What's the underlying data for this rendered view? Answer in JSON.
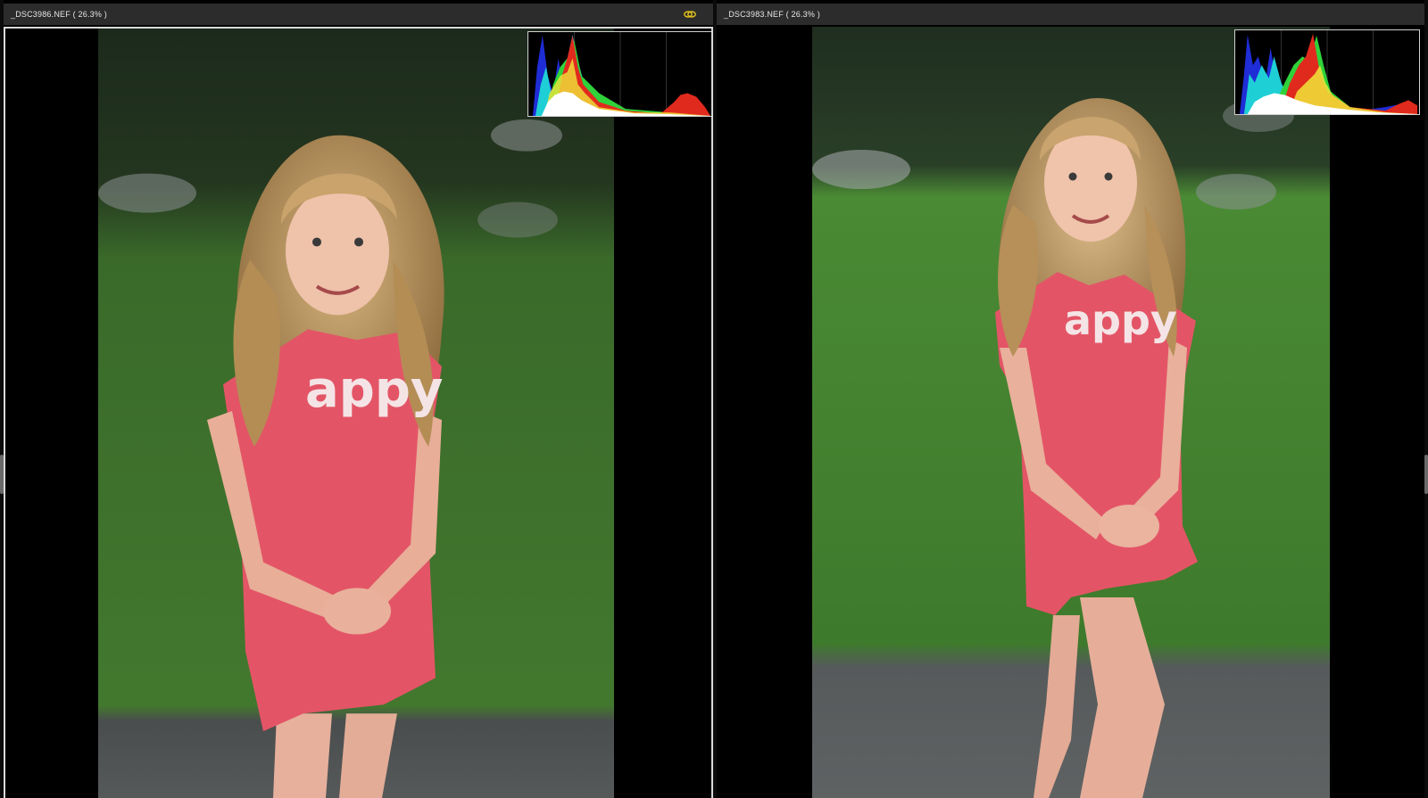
{
  "panes": [
    {
      "title": "_DSC3986.NEF ( 26.3% )",
      "zoom": "26.3%",
      "selected": true,
      "shirt_text": "appy"
    },
    {
      "title": "_DSC3983.NEF ( 26.3% )",
      "zoom": "26.3%",
      "selected": false,
      "shirt_text": "appy"
    }
  ],
  "icons": {
    "link": "link-icon",
    "link_color": "#e2c21a"
  },
  "colors": {
    "header_bg": "#2c2c2c",
    "selection_border": "#d9d9d9",
    "shirt": "#e35566",
    "grass": "#3f7a2c"
  }
}
